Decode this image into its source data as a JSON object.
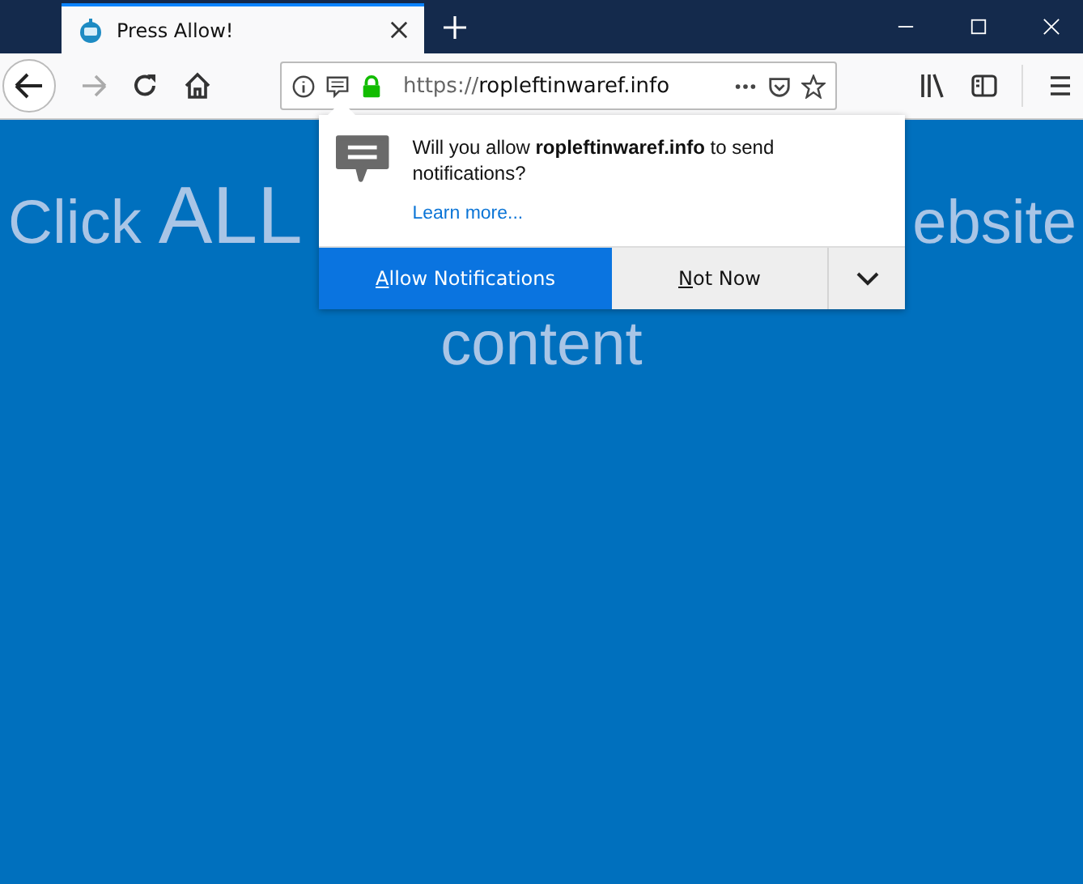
{
  "tab": {
    "title": "Press Allow!"
  },
  "address_bar": {
    "url_prefix": "https://",
    "url_host": "ropleftinwaref.info"
  },
  "page": {
    "heading_left_small": "Click",
    "heading_left_large": "ALL",
    "heading_right": "ebsite",
    "heading_line_2": "content"
  },
  "notification_prompt": {
    "message": "Will you allow **ropleftinwaref.info** to send notifications?",
    "learn_more": "Learn more...",
    "buttons": [
      {
        "kind": "primary",
        "access_letter": "A",
        "label_rest": "llow Notifications"
      },
      {
        "kind": "secondary",
        "access_letter": "N",
        "label_rest": "ot Now"
      }
    ]
  }
}
